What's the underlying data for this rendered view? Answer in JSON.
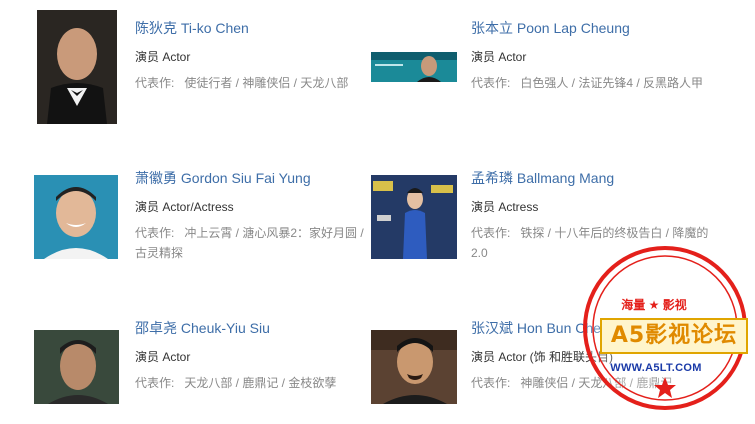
{
  "actors": [
    {
      "name": "陈狄克 Ti-ko Chen",
      "role": "演员 Actor",
      "works_label": "代表作:",
      "works": "使徒行者 / 神雕侠侣 / 天龙八部"
    },
    {
      "name": "张本立 Poon Lap Cheung",
      "role": "演员 Actor",
      "works_label": "代表作:",
      "works": "白色强人 / 法证先锋4 / 反黑路人甲"
    },
    {
      "name": "萧徽勇 Gordon Siu Fai Yung",
      "role": "演员 Actor/Actress",
      "works_label": "代表作:",
      "works": "冲上云霄 / 溏心风暴2：家好月圆 / 古灵精探"
    },
    {
      "name": "孟希璘 Ballmang Mang",
      "role": "演员 Actress",
      "works_label": "代表作:",
      "works": "铁探 / 十八年后的终极告白 / 降魔的2.0"
    },
    {
      "name": "邵卓尧 Cheuk-Yiu Siu",
      "role": "演员 Actor",
      "works_label": "代表作:",
      "works": "天龙八部 / 鹿鼎记 / 金枝欲孽"
    },
    {
      "name": "张汉斌 Hon Bun Cheung",
      "role": "演员 Actor (饰 和胜联头目)",
      "works_label": "代表作:",
      "works": "神雕侠侣 / 天龙八部 / 鹿鼎记"
    }
  ],
  "watermark": {
    "top_text": "海量 ★ 影视",
    "main_text": "A5影视论坛",
    "url": "WWW.A5LT.COM"
  },
  "colors": {
    "link": "#3e6ea8",
    "muted": "#888888",
    "stamp_red": "#e4201b"
  }
}
